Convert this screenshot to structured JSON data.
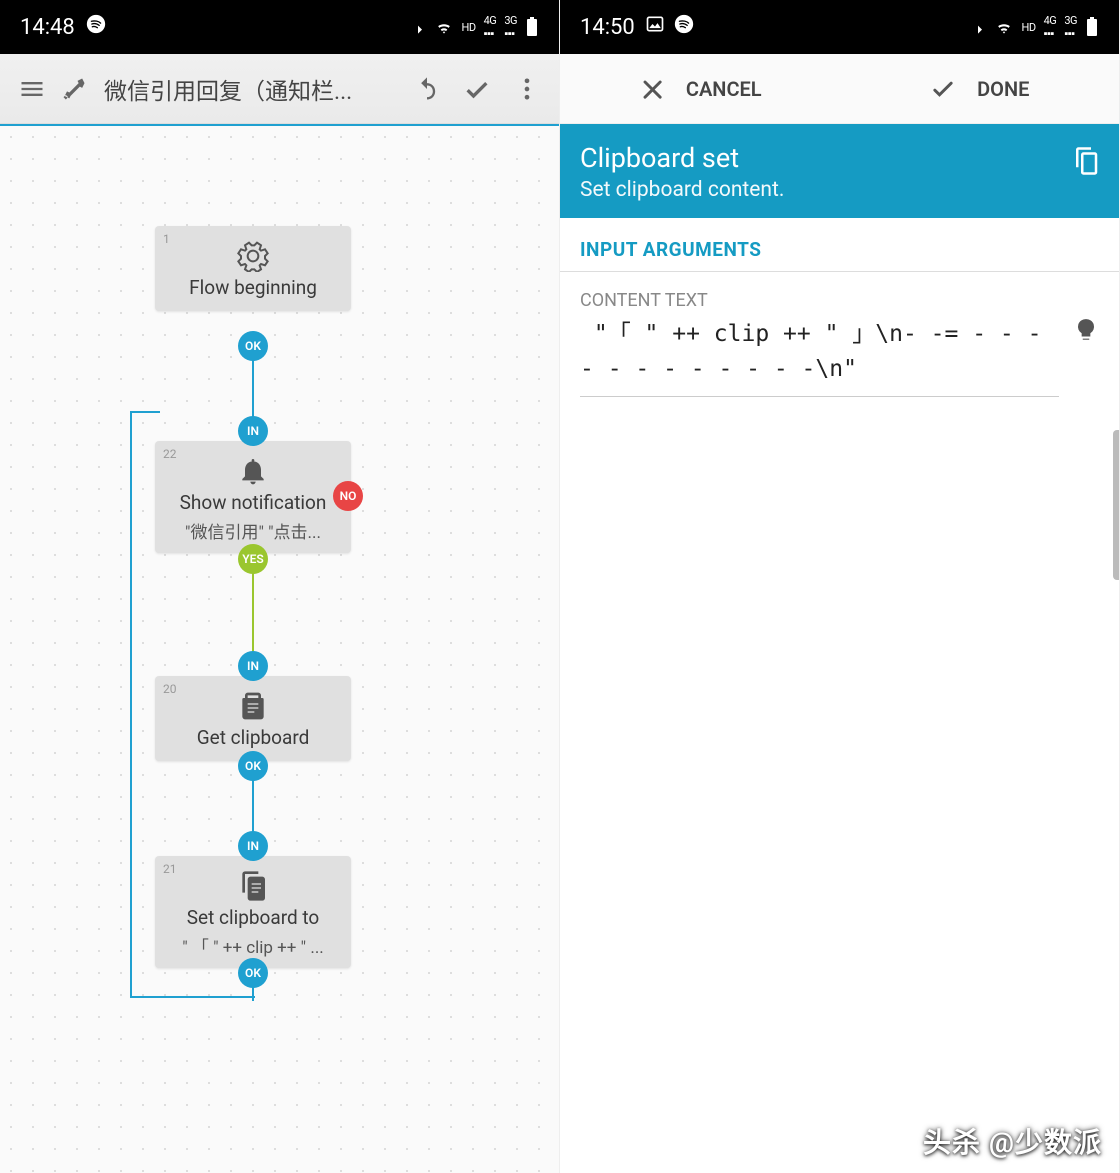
{
  "left": {
    "status": {
      "time": "14:48",
      "icons": "bt wifi hd 4g 3g bat spotify"
    },
    "appbar": {
      "title": "微信引用回复（通知栏..."
    },
    "blocks": [
      {
        "num": "1",
        "title": "Flow beginning",
        "sub": ""
      },
      {
        "num": "22",
        "title": "Show notification",
        "sub": "\"微信引用\" \"点击..."
      },
      {
        "num": "20",
        "title": "Get clipboard",
        "sub": ""
      },
      {
        "num": "21",
        "title": "Set clipboard to",
        "sub": "\" 「 \" ++ clip ++ \" ..."
      }
    ],
    "pins": {
      "ok": "OK",
      "in": "IN",
      "yes": "YES",
      "no": "NO"
    }
  },
  "right": {
    "status": {
      "time": "14:50"
    },
    "appbar": {
      "cancel": "CANCEL",
      "done": "DONE"
    },
    "header": {
      "title": "Clipboard set",
      "sub": "Set clipboard content."
    },
    "section": {
      "head": "INPUT ARGUMENTS",
      "field_label": "CONTENT TEXT",
      "field_value": " \"「 \" ++ clip ++ \" 」\\n- -= - - - - - - - - - - - -\\n\""
    }
  },
  "watermark": "头杀 @少数派"
}
